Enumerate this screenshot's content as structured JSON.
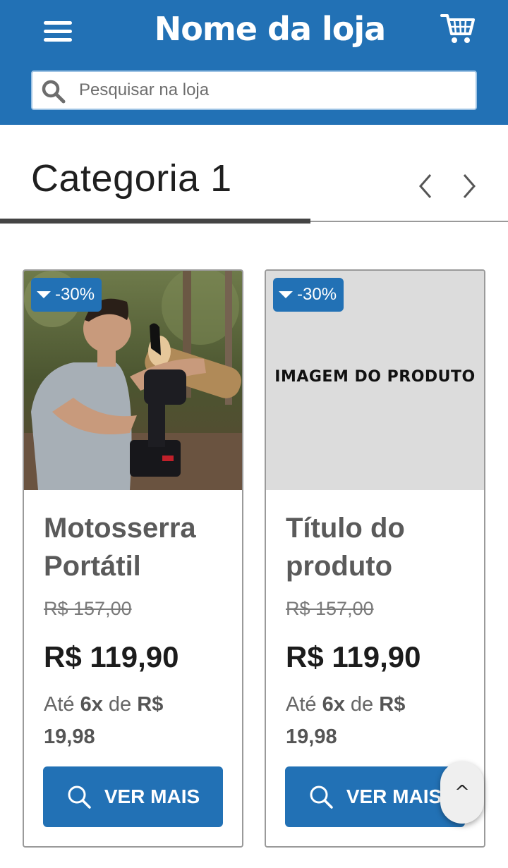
{
  "header": {
    "store_name": "Nome da loja",
    "menu_icon": "hamburger-menu-icon",
    "cart_icon": "shopping-cart-icon",
    "bg_color": "#2271b5"
  },
  "search": {
    "placeholder": "Pesquisar na loja",
    "icon": "search-icon"
  },
  "category": {
    "title": "Categoria 1",
    "prev_icon": "chevron-left-icon",
    "next_icon": "chevron-right-icon"
  },
  "products": [
    {
      "discount": "-30%",
      "image": "man-holding-chainsaw-cutting-log-photo",
      "title": "Motosserra Portátil",
      "old_price": "R$ 157,00",
      "price": "R$ 119,90",
      "installment_prefix": "Até",
      "installment_count": "6x",
      "installment_mid": "de",
      "installment_value": "R$ 19,98",
      "button_label": "VER MAIS"
    },
    {
      "discount": "-30%",
      "image_text": "IMAGEM DO PRODUTO",
      "title": "Título do produto",
      "old_price": "R$ 157,00",
      "price": "R$ 119,90",
      "installment_prefix": "Até",
      "installment_count": "6x",
      "installment_mid": "de",
      "installment_value": "R$ 19,98",
      "button_label": "VER MAIS"
    }
  ],
  "back_to_top": {
    "label": "^"
  }
}
